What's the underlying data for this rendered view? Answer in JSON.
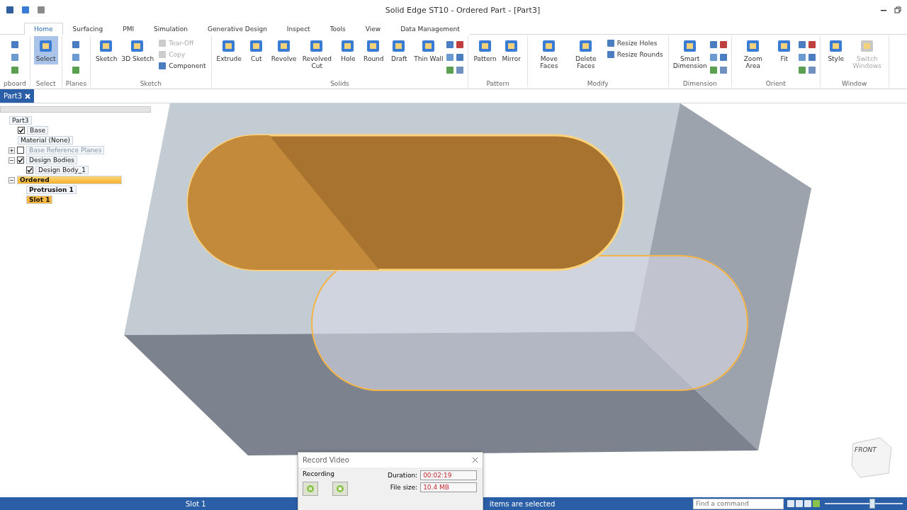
{
  "window": {
    "title": "Solid Edge ST10 - Ordered Part - [Part3]"
  },
  "tabs": [
    {
      "label": "Home",
      "selected": true
    },
    {
      "label": "Surfacing",
      "selected": false
    },
    {
      "label": "PMI",
      "selected": false
    },
    {
      "label": "Simulation",
      "selected": false
    },
    {
      "label": "Generative Design",
      "selected": false
    },
    {
      "label": "Inspect",
      "selected": false
    },
    {
      "label": "Tools",
      "selected": false
    },
    {
      "label": "View",
      "selected": false
    },
    {
      "label": "Data Management",
      "selected": false
    }
  ],
  "ribbon": [
    {
      "label": "pboard"
    },
    {
      "label": "Select",
      "buttons": [
        {
          "label": "Select",
          "kind": "large",
          "selected": true,
          "disabled": false
        }
      ]
    },
    {
      "label": "Planes"
    },
    {
      "label": "Sketch",
      "buttons": [
        {
          "label": "Sketch",
          "kind": "large",
          "selected": false,
          "disabled": false
        },
        {
          "label": "3D Sketch",
          "kind": "large",
          "selected": false,
          "disabled": false
        },
        {
          "label": "Tear-Off",
          "kind": "small",
          "selected": false,
          "disabled": true
        },
        {
          "label": "Copy",
          "kind": "small",
          "selected": false,
          "disabled": true
        },
        {
          "label": "Component",
          "kind": "small",
          "selected": false,
          "disabled": false
        }
      ]
    },
    {
      "label": "Solids",
      "buttons": [
        {
          "label": "Extrude",
          "kind": "large",
          "selected": false,
          "disabled": false
        },
        {
          "label": "Cut",
          "kind": "large",
          "selected": false,
          "disabled": false
        },
        {
          "label": "Revolve",
          "kind": "large",
          "selected": false,
          "disabled": false
        },
        {
          "label": "Revolved Cut",
          "kind": "large",
          "selected": false,
          "disabled": false
        },
        {
          "label": "Hole",
          "kind": "large",
          "selected": false,
          "disabled": false
        },
        {
          "label": "Round",
          "kind": "large",
          "selected": false,
          "disabled": false
        },
        {
          "label": "Draft",
          "kind": "large",
          "selected": false,
          "disabled": false
        },
        {
          "label": "Thin Wall",
          "kind": "large",
          "selected": false,
          "disabled": false
        }
      ]
    },
    {
      "label": "Pattern",
      "buttons": [
        {
          "label": "Pattern",
          "kind": "large",
          "selected": false,
          "disabled": false
        },
        {
          "label": "Mirror",
          "kind": "large",
          "selected": false,
          "disabled": false
        }
      ]
    },
    {
      "label": "Modify",
      "buttons": [
        {
          "label": "Move Faces",
          "kind": "large",
          "selected": false,
          "disabled": false
        },
        {
          "label": "Delete Faces",
          "kind": "large",
          "selected": false,
          "disabled": false
        },
        {
          "label": "Resize Holes",
          "kind": "small",
          "selected": false,
          "disabled": false
        },
        {
          "label": "Resize Rounds",
          "kind": "small",
          "selected": false,
          "disabled": false
        }
      ]
    },
    {
      "label": "Dimension",
      "buttons": [
        {
          "label": "Smart Dimension",
          "kind": "large",
          "selected": false,
          "disabled": false
        }
      ]
    },
    {
      "label": "Orient",
      "buttons": [
        {
          "label": "Zoom Area",
          "kind": "large",
          "selected": false,
          "disabled": false
        },
        {
          "label": "Fit",
          "kind": "large",
          "selected": false,
          "disabled": false
        }
      ]
    },
    {
      "label": "Window",
      "buttons": [
        {
          "label": "Style",
          "kind": "large",
          "selected": false,
          "disabled": false
        },
        {
          "label": "Switch Windows",
          "kind": "large",
          "selected": false,
          "disabled": true
        }
      ]
    }
  ],
  "document_tab": {
    "label": "Part3"
  },
  "tree": [
    {
      "label": "Part3",
      "kind": "node",
      "selected": false,
      "disabled": false,
      "children": [
        {
          "label": "Base",
          "kind": "node",
          "checked": true,
          "selected": false,
          "disabled": false
        },
        {
          "label": "Material (None)",
          "kind": "node",
          "selected": false,
          "disabled": false
        },
        {
          "label": "Base Reference Planes",
          "kind": "node",
          "checked": false,
          "expanded": false,
          "selected": false,
          "disabled": true
        },
        {
          "label": "Design Bodies",
          "kind": "node",
          "checked": true,
          "expanded": true,
          "selected": false,
          "disabled": false,
          "children": [
            {
              "label": "Design Body_1",
              "kind": "node",
              "checked": true,
              "selected": false,
              "disabled": false
            }
          ]
        },
        {
          "label": "Ordered",
          "kind": "section",
          "expanded": true,
          "selected": false,
          "disabled": false,
          "children": [
            {
              "label": "Protrusion 1",
              "kind": "feature",
              "selected": false,
              "disabled": false
            },
            {
              "label": "Slot 1",
              "kind": "feature",
              "selected": true,
              "disabled": false
            }
          ]
        }
      ]
    }
  ],
  "viewcube": {
    "label": "FRONT"
  },
  "record_dialog": {
    "title": "Record Video",
    "section": "Recording",
    "fields": [
      {
        "label": "Duration:",
        "value": "00:02:19"
      },
      {
        "label": "File size:",
        "value": "10.4 MB"
      }
    ]
  },
  "status_bar": {
    "left": "Slot 1",
    "center": "items are selected",
    "search": {
      "placeholder": "Find a command"
    },
    "zoom": {
      "level": 0.6
    }
  }
}
